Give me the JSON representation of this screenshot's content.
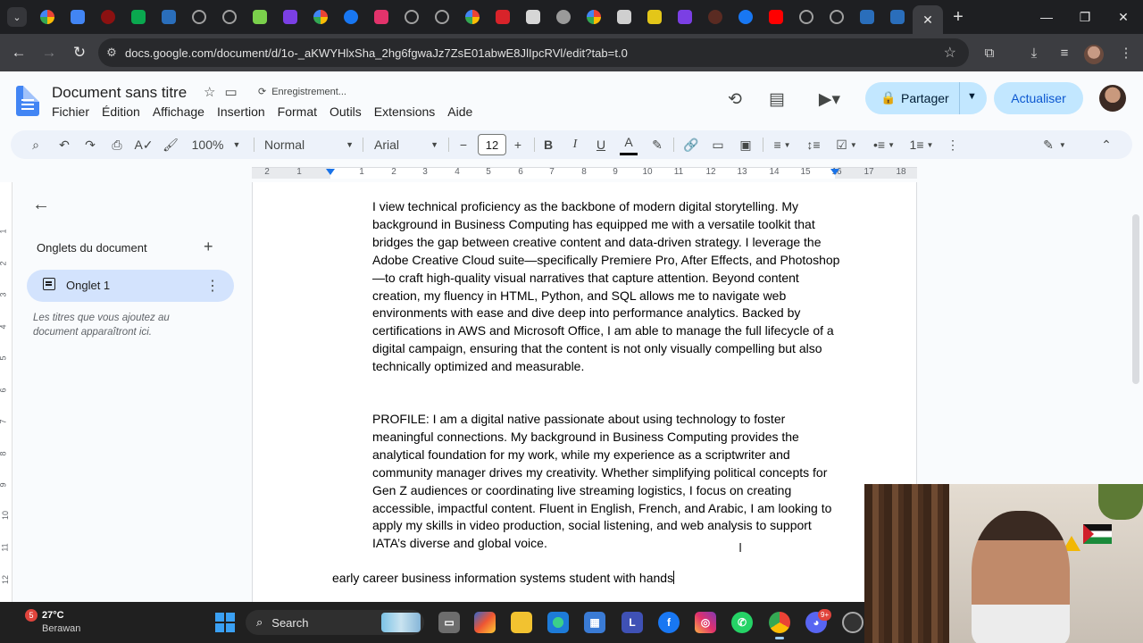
{
  "browser": {
    "url": "docs.google.com/document/d/1o-_aKWYHlxSha_2hg6fgwaJz7ZsE01abwE8JlIpcRVl/edit?tab=t.0",
    "tab_new_symbol": "+",
    "tab_close_symbol": "✕"
  },
  "docs": {
    "title": "Document sans titre",
    "saving_status": "Enregistrement...",
    "menus": [
      "Fichier",
      "Édition",
      "Affichage",
      "Insertion",
      "Format",
      "Outils",
      "Extensions",
      "Aide"
    ],
    "share_label": "Partager",
    "update_label": "Actualiser"
  },
  "toolbar": {
    "zoom": "100%",
    "style": "Normal",
    "font": "Arial",
    "font_size": "12"
  },
  "ruler": {
    "numbers": [
      "2",
      "1",
      "1",
      "2",
      "3",
      "4",
      "5",
      "6",
      "7",
      "8",
      "9",
      "10",
      "11",
      "12",
      "13",
      "14",
      "15",
      "16",
      "17",
      "18"
    ]
  },
  "vruler": {
    "numbers": [
      "1",
      "2",
      "3",
      "4",
      "5",
      "6",
      "7",
      "8",
      "9",
      "10",
      "11",
      "12"
    ]
  },
  "sidebar": {
    "heading": "Onglets du document",
    "tab_label": "Onglet 1",
    "hint": "Les titres que vous ajoutez au document apparaîtront ici."
  },
  "document": {
    "paragraph1": "I view technical proficiency as the backbone of modern digital storytelling. My background in Business Computing has equipped me with a versatile toolkit that bridges the gap between creative content and data-driven strategy. I leverage the Adobe Creative Cloud suite—specifically Premiere Pro, After Effects, and Photoshop —to craft high-quality visual narratives that capture attention. Beyond content creation, my fluency in HTML, Python, and SQL allows me to navigate web environments with ease and dive deep into performance analytics. Backed by certifications in AWS and Microsoft Office, I am able to manage the full lifecycle of a digital campaign, ensuring that the content is not only visually compelling but also technically optimized and measurable.",
    "paragraph2": "PROFILE: I am a digital native passionate about using technology to foster meaningful connections. My background in Business Computing provides the analytical foundation for my work, while my experience as a scriptwriter and community manager drives my creativity. Whether simplifying political concepts for Gen Z audiences or coordinating live streaming logistics, I focus on creating accessible, impactful content. Fluent in English, French, and Arabic, I am looking to apply my skills in video production, social listening, and web analysis to support IATA’s diverse and global voice.",
    "typing_line": "early career business information systems student with hands"
  },
  "taskbar": {
    "weather_badge": "5",
    "temperature": "27°C",
    "condition": "Berawan",
    "search_label": "Search",
    "discord_badge": "9+"
  },
  "colors": {
    "accent": "#0b57d0",
    "share_bg": "#c2e7ff",
    "tab_selected_bg": "#d3e3fd",
    "toolbar_bg": "#edf2fa"
  }
}
